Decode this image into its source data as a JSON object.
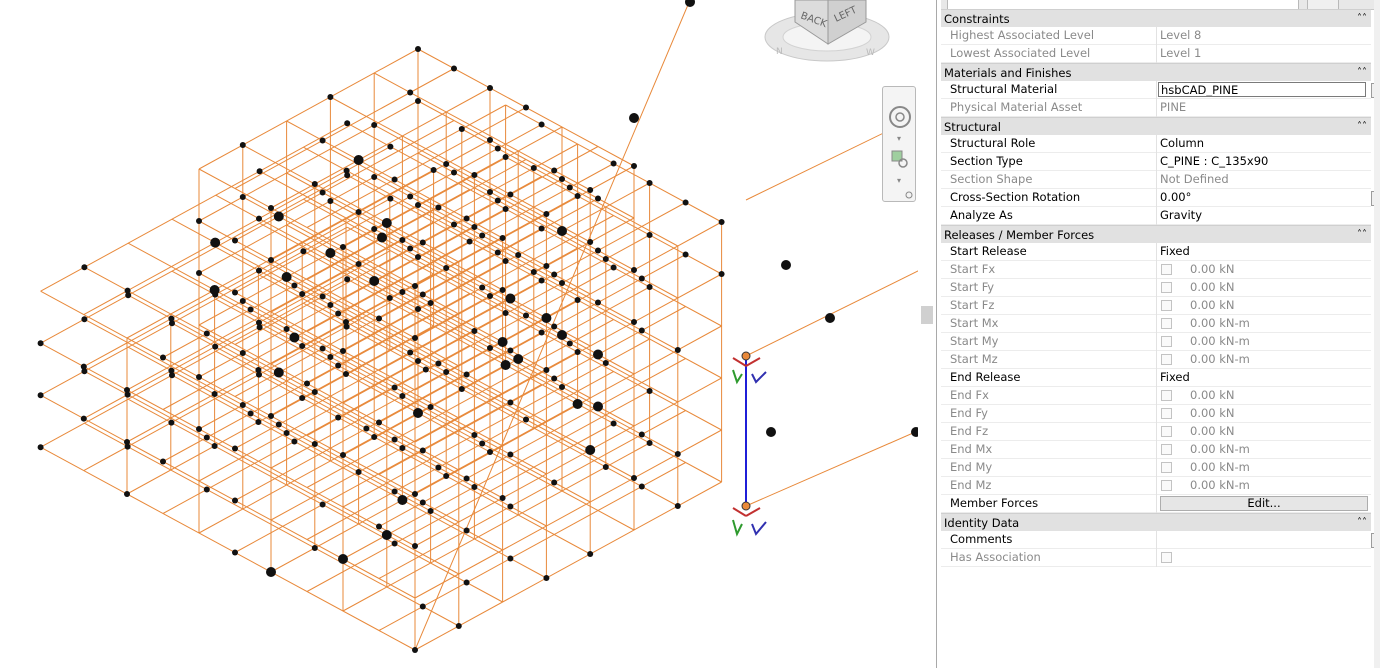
{
  "viewcube": {
    "back": "BACK",
    "left": "LEFT"
  },
  "colors": {
    "frame": "#e8893a",
    "node": "#111111",
    "selected": "#1f1fd8"
  },
  "properties": {
    "groups": [
      {
        "title": "Constraints",
        "rows": [
          {
            "label": "Highest Associated Level",
            "value": "Level 8",
            "disabled": true
          },
          {
            "label": "Lowest Associated Level",
            "value": "Level 1",
            "disabled": true
          }
        ]
      },
      {
        "title": "Materials and Finishes",
        "rows": [
          {
            "label": "Structural Material",
            "value": "hsbCAD_PINE",
            "input": true,
            "button": true
          },
          {
            "label": "Physical Material Asset",
            "value": "PINE",
            "disabled": true
          }
        ]
      },
      {
        "title": "Structural",
        "rows": [
          {
            "label": "Structural Role",
            "value": "Column"
          },
          {
            "label": "Section Type",
            "value": "C_PINE : C_135x90"
          },
          {
            "label": "Section Shape",
            "value": "Not Defined",
            "disabled": true
          },
          {
            "label": "Cross-Section Rotation",
            "value": "0.00°",
            "button": true
          },
          {
            "label": "Analyze As",
            "value": "Gravity"
          }
        ]
      },
      {
        "title": "Releases / Member Forces",
        "rows": [
          {
            "label": "Start Release",
            "value": "Fixed"
          },
          {
            "label": "Start Fx",
            "check": true,
            "value": "0.00 kN",
            "disabled": true
          },
          {
            "label": "Start Fy",
            "check": true,
            "value": "0.00 kN",
            "disabled": true
          },
          {
            "label": "Start Fz",
            "check": true,
            "value": "0.00 kN",
            "disabled": true
          },
          {
            "label": "Start Mx",
            "check": true,
            "value": "0.00 kN-m",
            "disabled": true
          },
          {
            "label": "Start My",
            "check": true,
            "value": "0.00 kN-m",
            "disabled": true
          },
          {
            "label": "Start Mz",
            "check": true,
            "value": "0.00 kN-m",
            "disabled": true
          },
          {
            "label": "End Release",
            "value": "Fixed"
          },
          {
            "label": "End Fx",
            "check": true,
            "value": "0.00 kN",
            "disabled": true
          },
          {
            "label": "End Fy",
            "check": true,
            "value": "0.00 kN",
            "disabled": true
          },
          {
            "label": "End Fz",
            "check": true,
            "value": "0.00 kN",
            "disabled": true
          },
          {
            "label": "End Mx",
            "check": true,
            "value": "0.00 kN-m",
            "disabled": true
          },
          {
            "label": "End My",
            "check": true,
            "value": "0.00 kN-m",
            "disabled": true
          },
          {
            "label": "End Mz",
            "check": true,
            "value": "0.00 kN-m",
            "disabled": true
          },
          {
            "label": "Member Forces",
            "value": "Edit...",
            "editButton": true
          }
        ]
      },
      {
        "title": "Identity Data",
        "rows": [
          {
            "label": "Comments",
            "value": "",
            "button": true
          },
          {
            "label": "Has Association",
            "check": true,
            "value": "",
            "disabled": true
          }
        ]
      }
    ]
  }
}
